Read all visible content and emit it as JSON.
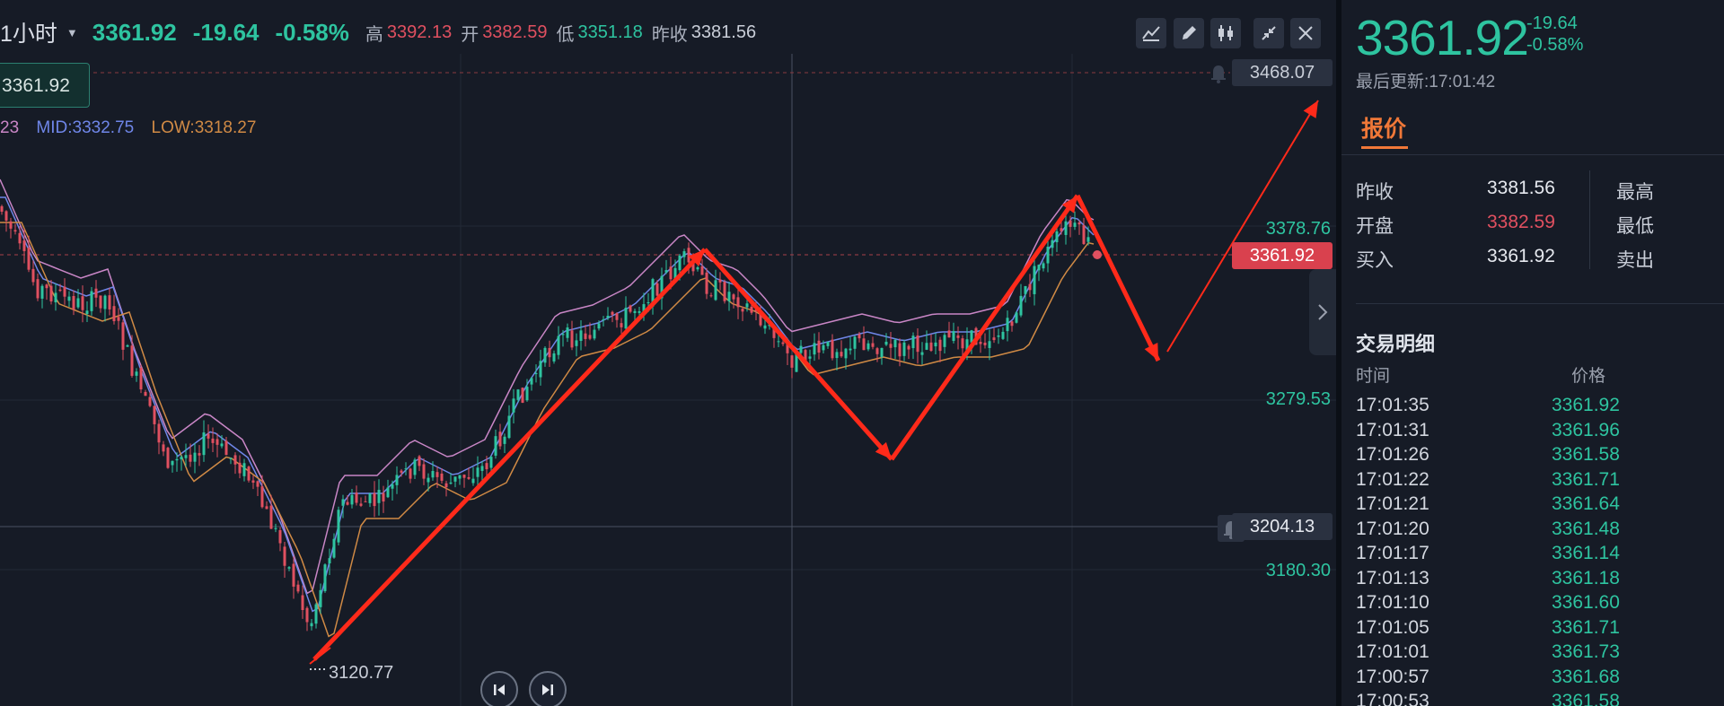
{
  "header": {
    "timeframe": "1小时",
    "last": "3361.92",
    "change": "-19.64",
    "change_pct": "-0.58%",
    "high_label": "高",
    "high": "3392.13",
    "open_label": "开",
    "open": "3382.59",
    "low_label": "低",
    "low": "3351.18",
    "prev_label": "昨收",
    "prev": "3381.56"
  },
  "toolbar": [
    "draw-line-icon",
    "pencil-icon",
    "candles-icon",
    "collapse-icon",
    "close-icon"
  ],
  "chart": {
    "price_tag": "3361.92",
    "indicator_up": "23",
    "indicator_mid": "MID:3332.75",
    "indicator_low": "LOW:3318.27",
    "alert_high": "3468.07",
    "axis_labels": [
      "3378.76",
      "3279.53",
      "3180.30"
    ],
    "current_price": "3361.92",
    "alert_low": "3204.13",
    "low_marker": "3120.77"
  },
  "chart_data": {
    "type": "candlestick",
    "symbol_timeframe": "1小时",
    "y_axis_ticks": [
      3378.76,
      3279.53,
      3180.3
    ],
    "last_price": 3361.92,
    "alert_levels": [
      3468.07,
      3204.13
    ],
    "marked_low": 3120.77,
    "bollinger": {
      "mid": 3332.75,
      "low": 3318.27
    },
    "swing_path": [
      3120.77,
      3375,
      3280,
      3392,
      3300,
      3470
    ]
  },
  "quote": {
    "price": "3361.92",
    "change": "-19.64",
    "change_pct": "-0.58%",
    "updated": "最后更新:17:01:42",
    "tab": "报价",
    "rows": [
      {
        "label": "昨收",
        "value": "3381.56",
        "label2": "最高"
      },
      {
        "label": "开盘",
        "value": "3382.59",
        "label2": "最低"
      },
      {
        "label": "买入",
        "value": "3361.92",
        "label2": "卖出"
      }
    ],
    "trades_title": "交易明细",
    "col_time": "时间",
    "col_price": "价格",
    "trades": [
      {
        "time": "17:01:35",
        "price": "3361.92"
      },
      {
        "time": "17:01:31",
        "price": "3361.96"
      },
      {
        "time": "17:01:26",
        "price": "3361.58"
      },
      {
        "time": "17:01:22",
        "price": "3361.71"
      },
      {
        "time": "17:01:21",
        "price": "3361.64"
      },
      {
        "time": "17:01:20",
        "price": "3361.48"
      },
      {
        "time": "17:01:17",
        "price": "3361.14"
      },
      {
        "time": "17:01:13",
        "price": "3361.18"
      },
      {
        "time": "17:01:10",
        "price": "3361.60"
      },
      {
        "time": "17:01:05",
        "price": "3361.71"
      },
      {
        "time": "17:01:01",
        "price": "3361.73"
      },
      {
        "time": "17:00:57",
        "price": "3361.68"
      },
      {
        "time": "17:00:53",
        "price": "3361.58"
      }
    ]
  },
  "colors": {
    "up": "#2ec4a0",
    "down": "#e05060",
    "accent": "#f07838",
    "arrow": "#ff2a1a"
  }
}
